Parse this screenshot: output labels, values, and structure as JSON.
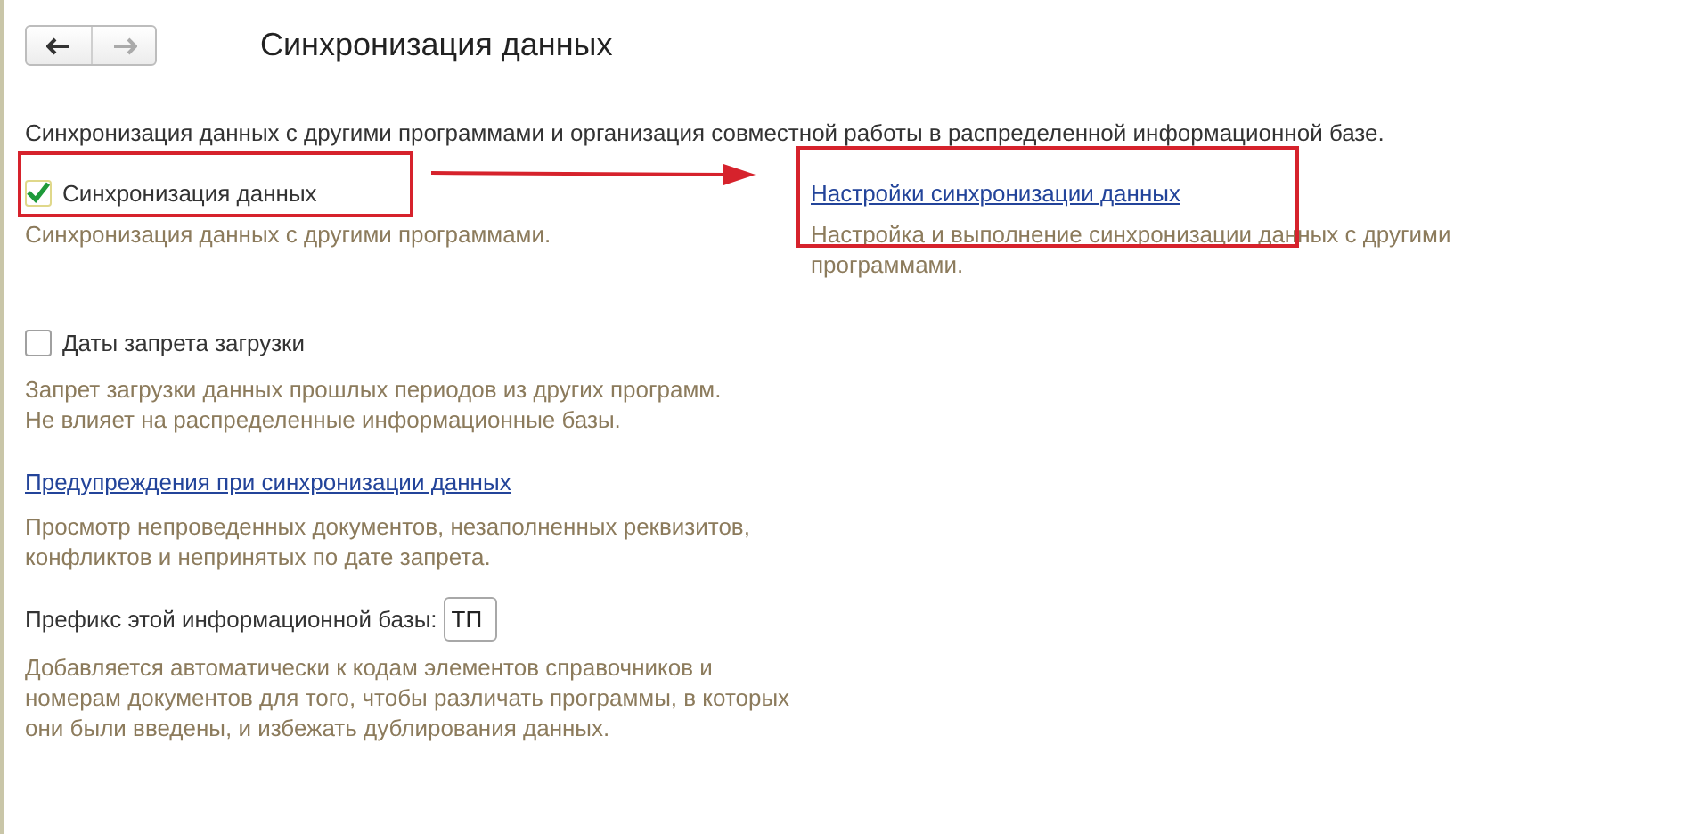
{
  "nav": {
    "back_disabled": false,
    "forward_disabled": true
  },
  "title": "Синхронизация данных",
  "description": "Синхронизация данных с другими программами и организация совместной работы в распределенной информационной базе.",
  "sync_option": {
    "label": "Синхронизация данных",
    "checked": true,
    "hint": "Синхронизация данных с другими программами."
  },
  "sync_settings": {
    "link": "Настройки синхронизации данных",
    "hint": "Настройка и выполнение синхронизации данных с другими программами."
  },
  "restriction_option": {
    "label": "Даты запрета загрузки",
    "checked": false,
    "hint_lines": [
      "Запрет загрузки данных прошлых периодов из других программ.",
      "Не влияет на распределенные информационные базы."
    ]
  },
  "warnings": {
    "link": "Предупреждения при синхронизации данных",
    "hint_lines": [
      "Просмотр непроведенных документов, незаполненных реквизитов,",
      "конфликтов и непринятых по дате запрета."
    ]
  },
  "prefix": {
    "label": "Префикс этой информационной базы:",
    "value": "ТП",
    "hint_lines": [
      "Добавляется автоматически к кодам элементов справочников и",
      "номерам документов для того, чтобы различать программы, в которых",
      "они были введены, и избежать дублирования данных."
    ]
  }
}
